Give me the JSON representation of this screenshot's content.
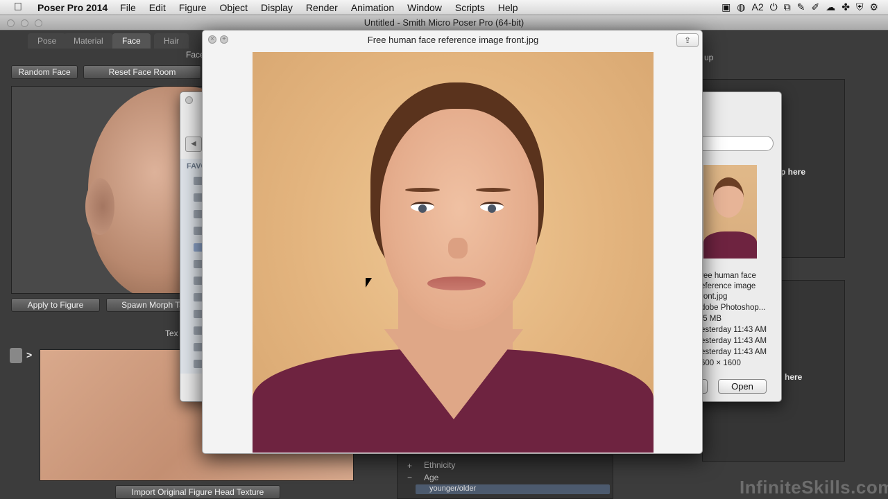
{
  "menubar": {
    "app_name": "Poser Pro 2014",
    "items": [
      "File",
      "Edit",
      "Figure",
      "Object",
      "Display",
      "Render",
      "Animation",
      "Window",
      "Scripts",
      "Help"
    ],
    "tray_badge": "2"
  },
  "window": {
    "title": "Untitled - Smith Micro Poser Pro  (64-bit)"
  },
  "room_tabs": [
    "Pose",
    "Material",
    "Face",
    "Hair"
  ],
  "face_room": {
    "section_label": "Face",
    "random_face": "Random Face",
    "reset_face_room": "Reset Face Room",
    "apply_to_figure": "Apply to Figure",
    "spawn_morph_target": "Spawn Morph Tar",
    "texture_label": "Tex",
    "import_texture": "Import Original Figure Head Texture"
  },
  "right_panel": {
    "top_label": "up",
    "drop_here_1": "p here",
    "drop_here_2": "here",
    "tree": [
      {
        "toggle": "+",
        "label": "Ethnicity"
      },
      {
        "toggle": "−",
        "label": "Age"
      }
    ],
    "selected_item": "younger/older"
  },
  "file_dialog": {
    "favorites_label": "FAVO",
    "info": {
      "name_line1": "ree human face",
      "name_line2": "eference image",
      "name_line3": "ront.jpg",
      "kind": "dobe Photoshop...",
      "size": ".5 MB",
      "created": "esterday 11:43 AM",
      "modified": "esterday 11:43 AM",
      "last_opened": "esterday 11:43 AM",
      "dimensions": "600 × 1600"
    },
    "open_button": "Open"
  },
  "quicklook": {
    "title": "Free human face reference image front.jpg",
    "share_icon": "share-icon"
  },
  "watermark": "InfiniteSkills.com"
}
